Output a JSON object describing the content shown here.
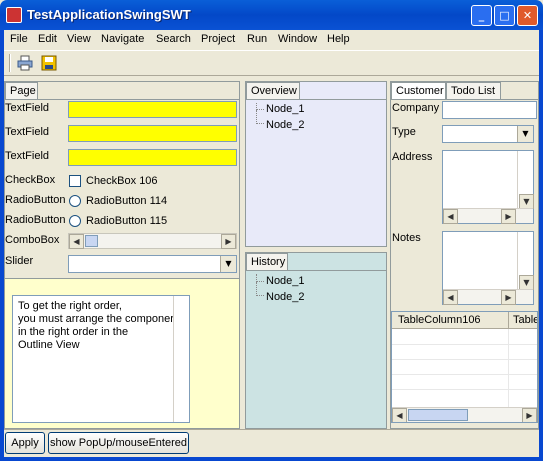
{
  "window": {
    "title": "TestApplicationSwingSWT",
    "min_label": "_",
    "max_label": "□",
    "close_label": "✕"
  },
  "menu": [
    "File",
    "Edit",
    "View",
    "Navigate",
    "Search",
    "Project",
    "Run",
    "Window",
    "Help"
  ],
  "toolbar": {
    "icons": [
      "print-icon",
      "save-icon"
    ]
  },
  "page_panel": {
    "tab": "Page",
    "rows": {
      "textfield1": "TextField",
      "textfield2": "TextField",
      "textfield3": "TextField",
      "checkbox_label": "CheckBox",
      "checkbox_text": "CheckBox 106",
      "radio1_label": "RadioButton",
      "radio1_text": "RadioButton 114",
      "radio2_label": "RadioButton",
      "radio2_text": "RadioButton 115",
      "combobox_label": "ComboBox",
      "slider_label": "Slider"
    },
    "note_lines": [
      "To get the right order,",
      "you must arrange the componer",
      "in the right order in the",
      "Outline View"
    ]
  },
  "overview_panel": {
    "tab": "Overview",
    "nodes": [
      "Node_1",
      "Node_2"
    ]
  },
  "history_panel": {
    "tab": "History",
    "nodes": [
      "Node_1",
      "Node_2"
    ]
  },
  "customer_panel": {
    "tabs": [
      "Customer",
      "Todo List"
    ],
    "labels": {
      "company": "Company",
      "type": "Type",
      "address": "Address",
      "notes": "Notes"
    },
    "table_columns": [
      "TableColumn106",
      "Table"
    ]
  },
  "footer": {
    "apply": "Apply",
    "popup": "show PopUp/mouseEntered"
  },
  "colors": {
    "titlebar": "#0348c8",
    "yellow_field": "#ffff00",
    "note_bg": "#ffffcc",
    "overview_bg": "#e8eaf9",
    "history_bg": "#cce3e3"
  }
}
